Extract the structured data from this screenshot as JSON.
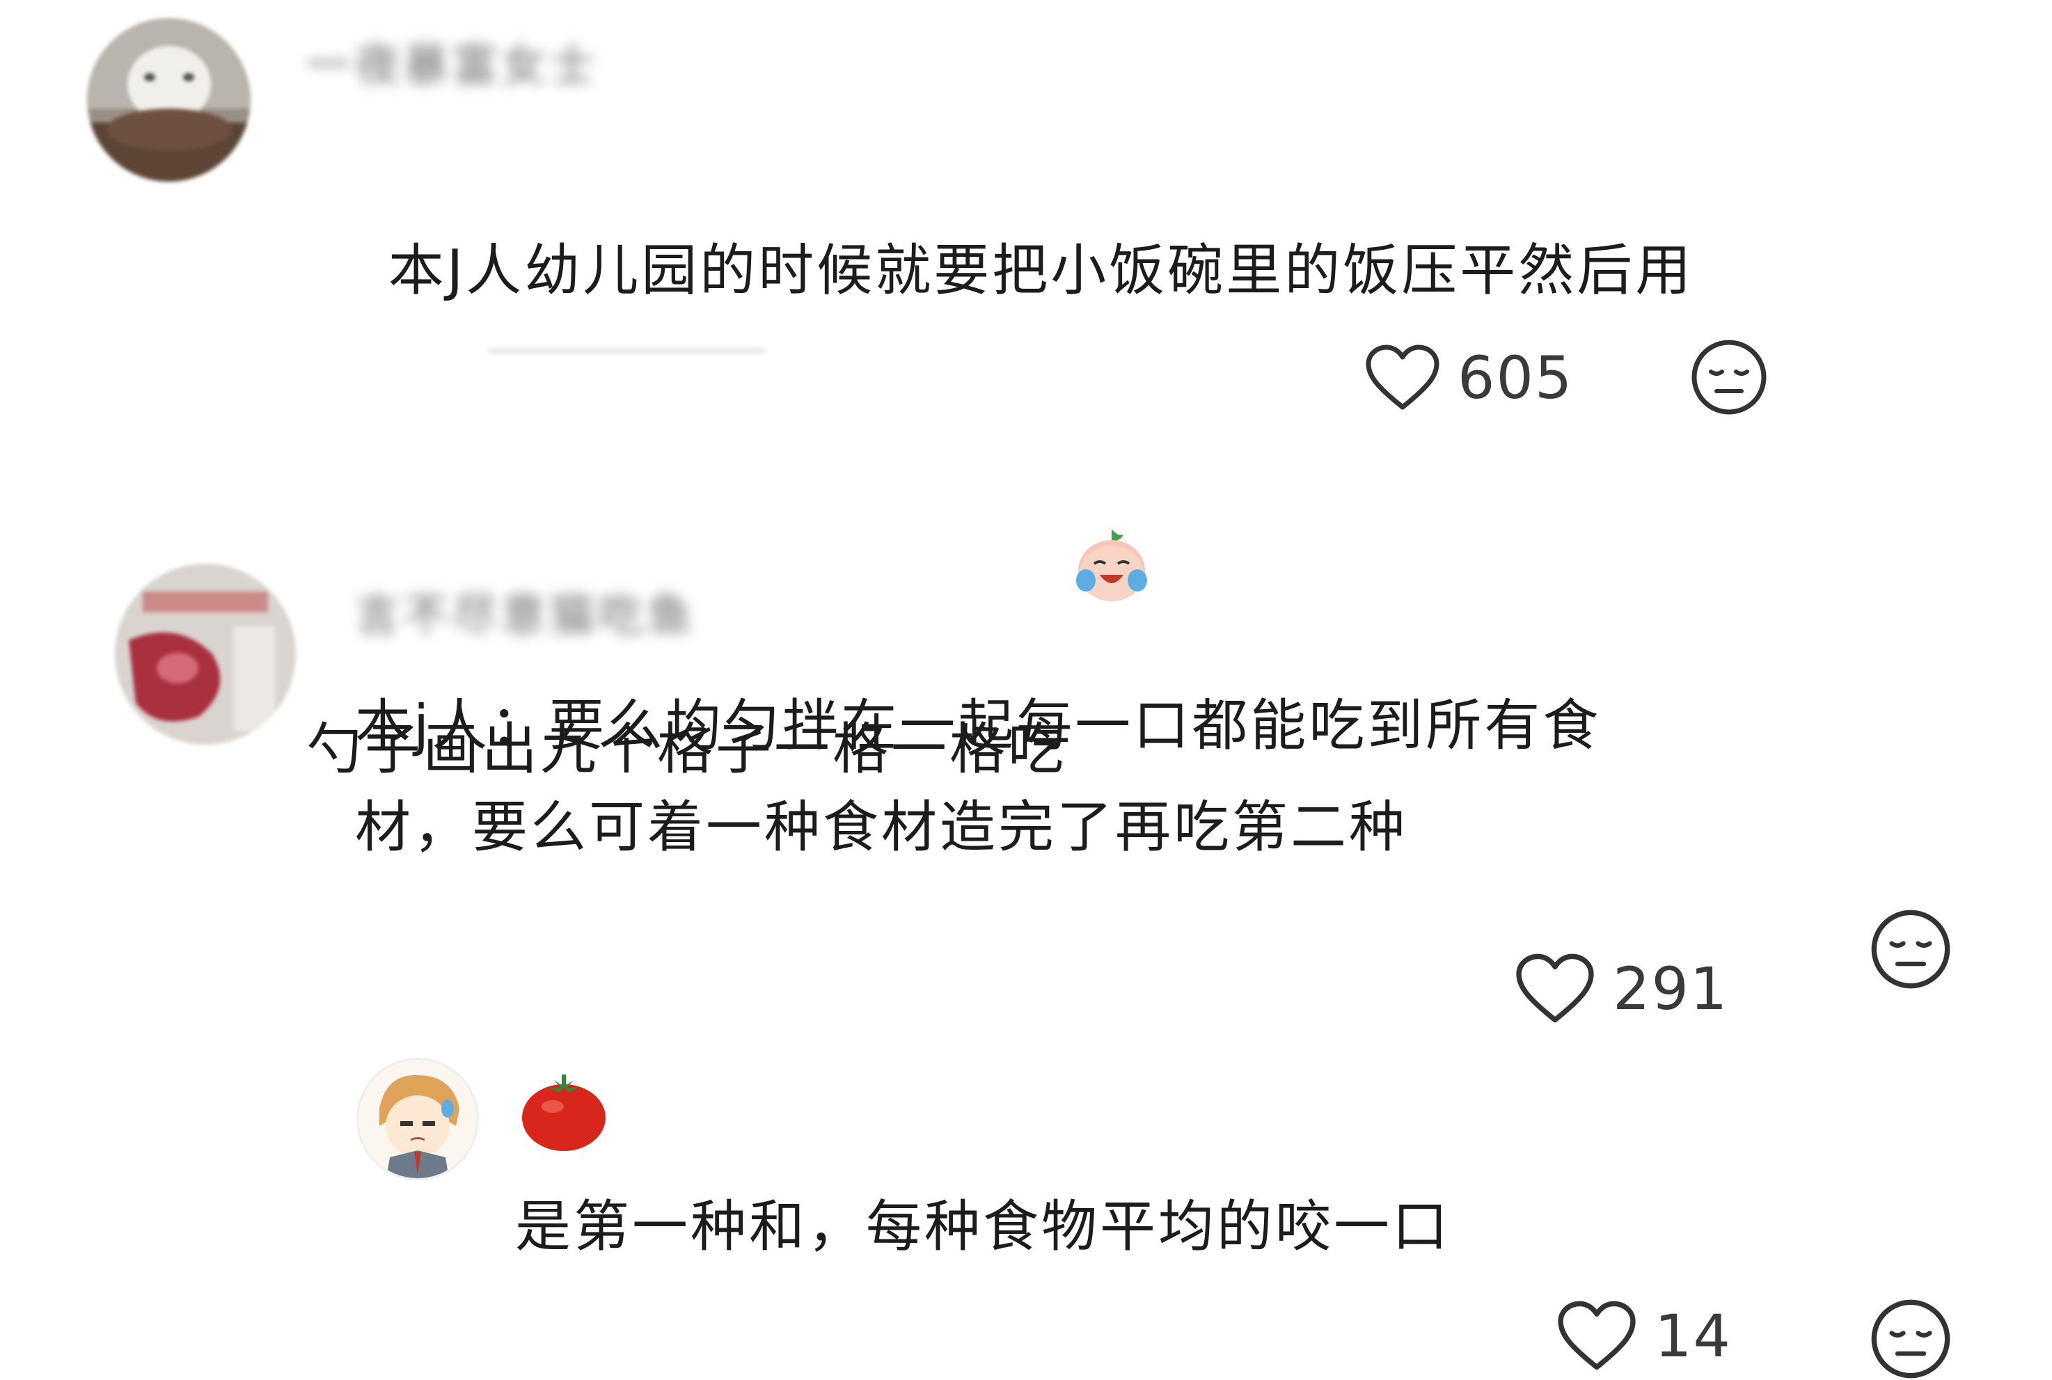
{
  "comments": [
    {
      "username": "一夜暴富女士",
      "text": "本J人幼儿园的时候就要把小饭碗里的饭压平然后用\n勺子画出九个格子一格一格吃",
      "emoji_icon": "crying-laughing-emoji-icon",
      "likes": "605"
    },
    {
      "username": "言不尽意猫吃鱼",
      "text": "本j人：要么均匀拌在一起每一口都能吃到所有食\n材，要么可着一种食材造完了再吃第二种",
      "likes": "291"
    }
  ],
  "reply": {
    "username_icon": "tomato-icon",
    "text": "是第一种和，每种食物平均的咬一口",
    "likes": "14"
  },
  "colors": {
    "text": "#1c1c1c",
    "count": "#3a3a3a",
    "icon_stroke": "#333333"
  }
}
